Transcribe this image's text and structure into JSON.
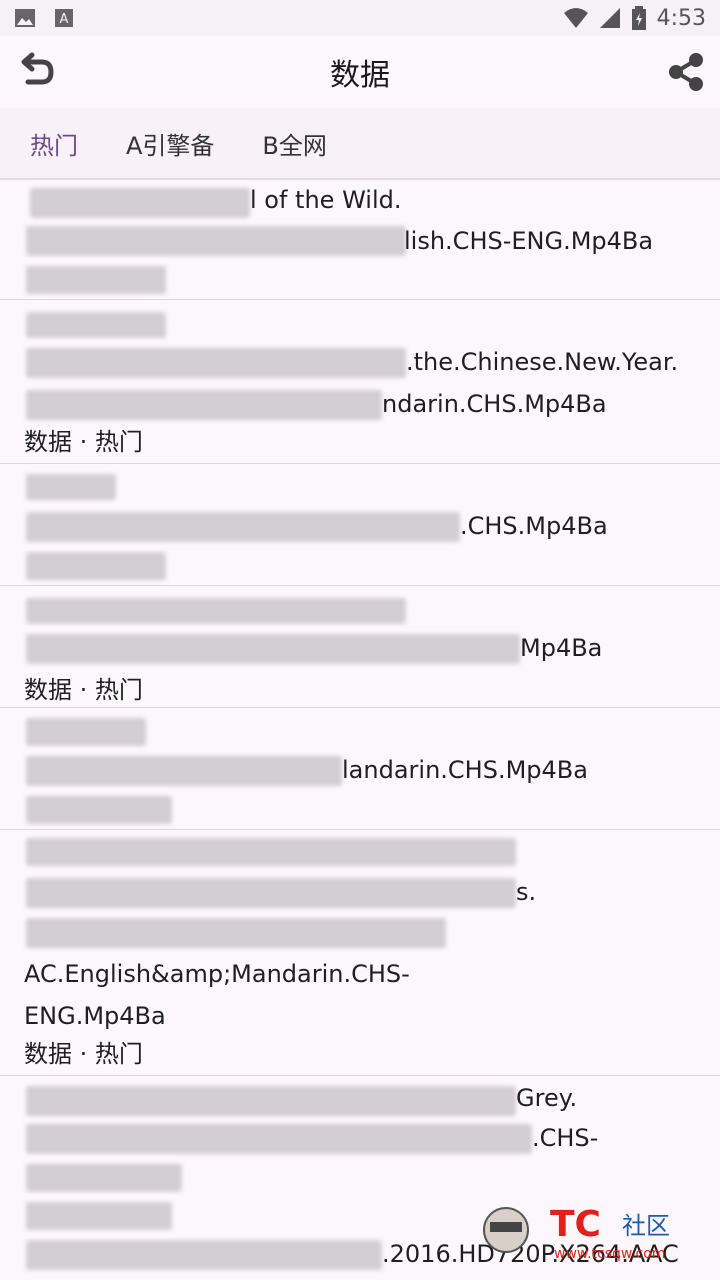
{
  "status_bar": {
    "time": "4:53"
  },
  "app_bar": {
    "title": "数据"
  },
  "tabs": [
    {
      "label": "热门",
      "active": true
    },
    {
      "label": "A引擎备",
      "active": false
    },
    {
      "label": "B全网",
      "active": false
    }
  ],
  "items": [
    {
      "lines": [
        "l of the Wild.",
        "lish.CHS-ENG.Mp4Ba"
      ]
    },
    {
      "lines": [
        ".the.Chinese.New.Year.",
        "ndarin.CHS.Mp4Ba",
        "数据 · 热门"
      ]
    },
    {
      "lines": [
        ".CHS.Mp4Ba"
      ]
    },
    {
      "lines": [
        "Mp4Ba",
        "数据 · 热门"
      ]
    },
    {
      "lines": [
        "landarin.CHS.Mp4Ba"
      ]
    },
    {
      "lines": [
        "s.",
        "AC.English&amp;Mandarin.CHS-",
        "ENG.Mp4Ba",
        "数据 · 热门"
      ]
    },
    {
      "lines": [
        "Grey.",
        ".CHS-",
        ".2016.HD720P.X264.AAC"
      ]
    }
  ],
  "watermark": {
    "text": "社区",
    "site": "www.tcsqw.com",
    "brand": "TC"
  },
  "colors": {
    "accent": "#6a4a8a",
    "background": "#fcf7fb",
    "divider": "#ded6dc"
  }
}
